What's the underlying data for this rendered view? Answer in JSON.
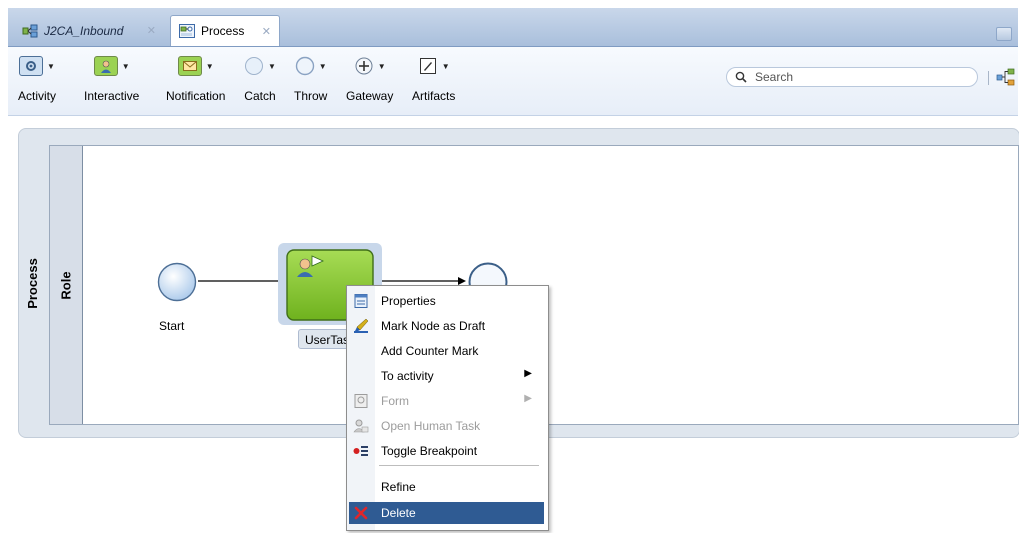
{
  "tabs": [
    {
      "label": "J2CA_Inbound",
      "active": false
    },
    {
      "label": "Process",
      "active": true
    }
  ],
  "toolbar": {
    "tools": [
      {
        "label": "Activity",
        "icon": "activity-icon"
      },
      {
        "label": "Interactive",
        "icon": "interactive-icon"
      },
      {
        "label": "Notification",
        "icon": "notification-icon"
      },
      {
        "label": "Catch",
        "icon": "catch-event-icon"
      },
      {
        "label": "Throw",
        "icon": "throw-event-icon"
      },
      {
        "label": "Gateway",
        "icon": "gateway-icon"
      },
      {
        "label": "Artifacts",
        "icon": "artifacts-icon"
      }
    ],
    "search_placeholder": "Search"
  },
  "diagram": {
    "pool_label": "Process",
    "lane_label": "Role",
    "start_label": "Start",
    "task_label": "UserTas"
  },
  "context_menu": {
    "items": [
      {
        "label": "Properties",
        "icon": "properties-icon",
        "enabled": true
      },
      {
        "label": "Mark Node as Draft",
        "icon": "mark-draft-icon",
        "enabled": true
      },
      {
        "label": "Add Counter Mark",
        "icon": "",
        "enabled": true
      },
      {
        "label": "To activity",
        "icon": "",
        "enabled": true,
        "submenu": true
      },
      {
        "label": "Form",
        "icon": "form-icon",
        "enabled": false,
        "submenu": true
      },
      {
        "label": "Open Human Task",
        "icon": "human-task-icon",
        "enabled": false
      },
      {
        "label": "Toggle Breakpoint",
        "icon": "breakpoint-icon",
        "enabled": true
      },
      {
        "label": "Refine",
        "icon": "",
        "enabled": true
      },
      {
        "label": "Delete",
        "icon": "delete-icon",
        "enabled": true,
        "selected": true
      }
    ]
  },
  "colors": {
    "tab_strip": "#b6c8e0",
    "menu_selection": "#2f5b93",
    "task_fill": "#8fcc3c",
    "event_fill": "#cfe2f7",
    "pool_fill": "#dfe6ee"
  }
}
